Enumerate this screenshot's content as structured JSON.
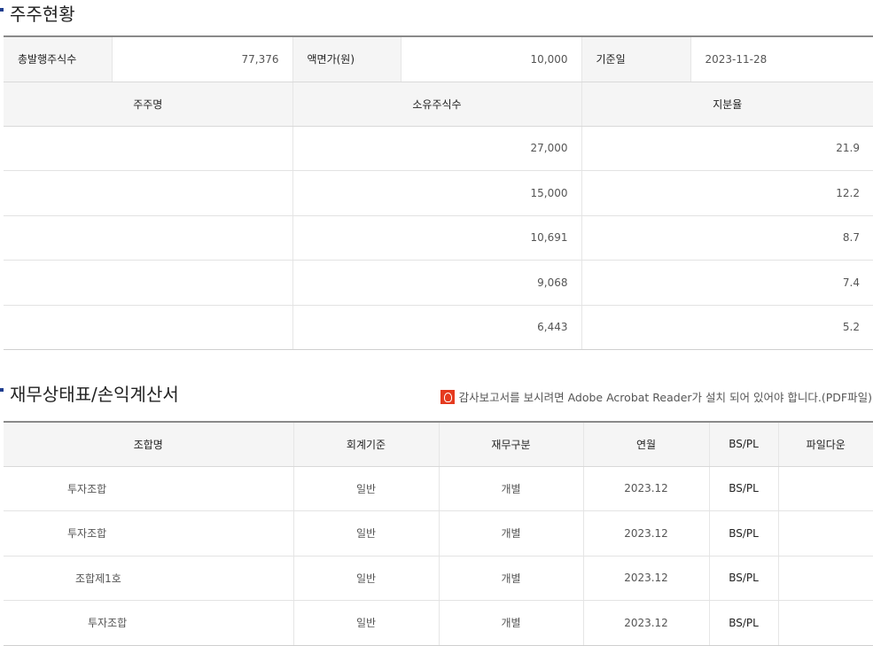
{
  "shareholders": {
    "title": "주주현황",
    "meta": {
      "total_shares_label": "총발행주식수",
      "total_shares_value": "77,376",
      "par_value_label": "액면가(원)",
      "par_value_value": "10,000",
      "base_date_label": "기준일",
      "base_date_value": "2023-11-28"
    },
    "columns": [
      "주주명",
      "소유주식수",
      "지분율"
    ],
    "rows": [
      {
        "name": "",
        "shares": "27,000",
        "ratio": "21.9"
      },
      {
        "name": "",
        "shares": "15,000",
        "ratio": "12.2"
      },
      {
        "name": "",
        "shares": "10,691",
        "ratio": "8.7"
      },
      {
        "name": "",
        "shares": "9,068",
        "ratio": "7.4"
      },
      {
        "name": "",
        "shares": "6,443",
        "ratio": "5.2"
      }
    ]
  },
  "financials": {
    "title": "재무상태표/손익계산서",
    "notice": "감사보고서를 보시려면 Adobe Acrobat Reader가 설치 되어 있어야 합니다.(PDF파일)",
    "notice_icon": "pdf-icon",
    "columns": [
      "조합명",
      "회계기준",
      "재무구분",
      "연월",
      "BS/PL",
      "파일다운"
    ],
    "rows": [
      {
        "org": "투자조합",
        "standard": "일반",
        "type": "개별",
        "period": "2023.12",
        "bspl": "BS/PL",
        "file": ""
      },
      {
        "org": "투자조합",
        "standard": "일반",
        "type": "개별",
        "period": "2023.12",
        "bspl": "BS/PL",
        "file": ""
      },
      {
        "org": "조합제1호",
        "standard": "일반",
        "type": "개별",
        "period": "2023.12",
        "bspl": "BS/PL",
        "file": ""
      },
      {
        "org": "투자조합",
        "standard": "일반",
        "type": "개별",
        "period": "2023.12",
        "bspl": "BS/PL",
        "file": ""
      }
    ]
  }
}
